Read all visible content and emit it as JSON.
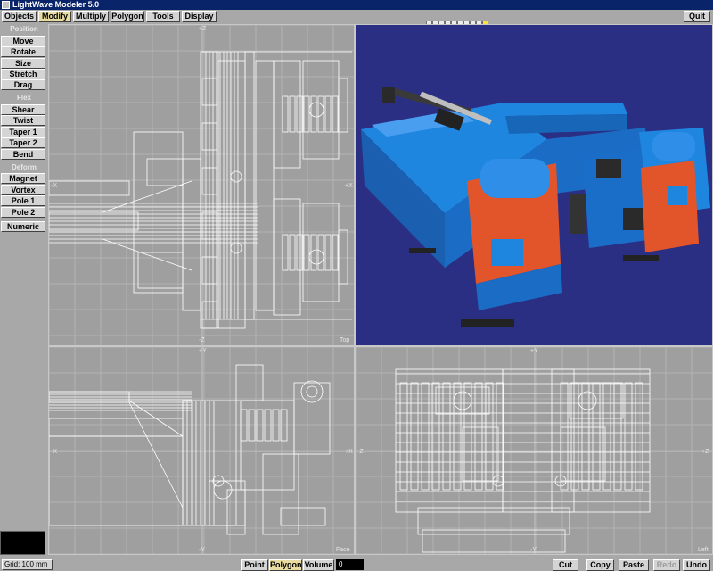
{
  "window": {
    "title": "LightWave Modeler 5.0"
  },
  "menu": {
    "tabs": [
      {
        "label": "Objects",
        "active": false
      },
      {
        "label": "Modify",
        "active": true
      },
      {
        "label": "Multiply",
        "active": false
      },
      {
        "label": "Polygon",
        "active": false
      },
      {
        "label": "Tools",
        "active": false
      },
      {
        "label": "Display",
        "active": false
      }
    ],
    "quit_label": "Quit",
    "layers": {
      "top_row": [
        false,
        false,
        false,
        false,
        false,
        false,
        false,
        false,
        false,
        true
      ],
      "bottom_row": [
        false,
        false,
        false,
        false,
        false,
        false,
        false,
        false,
        false,
        true
      ]
    }
  },
  "sidebar": {
    "position": {
      "header": "Position",
      "items": [
        "Move",
        "Rotate",
        "Size",
        "Stretch",
        "Drag"
      ]
    },
    "flex": {
      "header": "Flex",
      "items": [
        "Shear",
        "Twist",
        "Taper 1",
        "Taper 2",
        "Bend"
      ]
    },
    "deform": {
      "header": "Deform",
      "items": [
        "Magnet",
        "Vortex",
        "Pole 1",
        "Pole 2"
      ]
    },
    "numeric_label": "Numeric"
  },
  "viewports": {
    "top": {
      "name": "Top",
      "axes": {
        "up": "+Z",
        "down": "-Z",
        "left": "-X",
        "right": "+X"
      }
    },
    "face": {
      "name": "Face",
      "axes": {
        "up": "+Y",
        "down": "-Y",
        "left": "-X",
        "right": "+X"
      }
    },
    "left": {
      "name": "Left",
      "axes": {
        "up": "+Y",
        "down": "-Y",
        "left": "-Z",
        "right": "+Z"
      }
    },
    "perspective": {
      "background": "#2b2f84",
      "body_color": "#1f86e0",
      "accent_color": "#e2552a"
    }
  },
  "statusbar": {
    "grid": "Grid: 100 mm",
    "modes": [
      {
        "label": "Point",
        "active": false
      },
      {
        "label": "Polygon",
        "active": true
      },
      {
        "label": "Volume",
        "active": false
      }
    ],
    "count": "0",
    "edit": [
      {
        "label": "Cut",
        "enabled": true
      },
      {
        "label": "Copy",
        "enabled": true
      },
      {
        "label": "Paste",
        "enabled": true
      },
      {
        "label": "Redo",
        "enabled": false
      },
      {
        "label": "Undo",
        "enabled": true
      }
    ]
  }
}
